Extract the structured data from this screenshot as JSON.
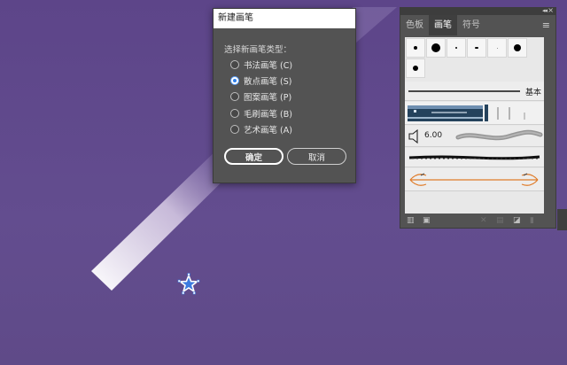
{
  "dialog": {
    "title": "新建画笔",
    "prompt": "选择新画笔类型：",
    "options": [
      {
        "label": "书法画笔 (C)",
        "checked": false
      },
      {
        "label": "散点画笔 (S)",
        "checked": true
      },
      {
        "label": "图案画笔 (P)",
        "checked": false
      },
      {
        "label": "毛刷画笔 (B)",
        "checked": false
      },
      {
        "label": "艺术画笔 (A)",
        "checked": false
      }
    ],
    "ok_label": "确定",
    "cancel_label": "取消"
  },
  "panel": {
    "tabs": [
      {
        "label": "色板",
        "active": false
      },
      {
        "label": "画笔",
        "active": true
      },
      {
        "label": "符号",
        "active": false
      }
    ],
    "collapse_glyph": "◂◂",
    "close_glyph": "×",
    "menu_glyph": "≡",
    "basic_label": "基本",
    "bristle_size": "6.00"
  },
  "colors": {
    "canvas": "#634c8c",
    "panel_bg": "#535353",
    "accent_radio": "#2f7fea",
    "art_brush_orange": "#e07b28"
  }
}
